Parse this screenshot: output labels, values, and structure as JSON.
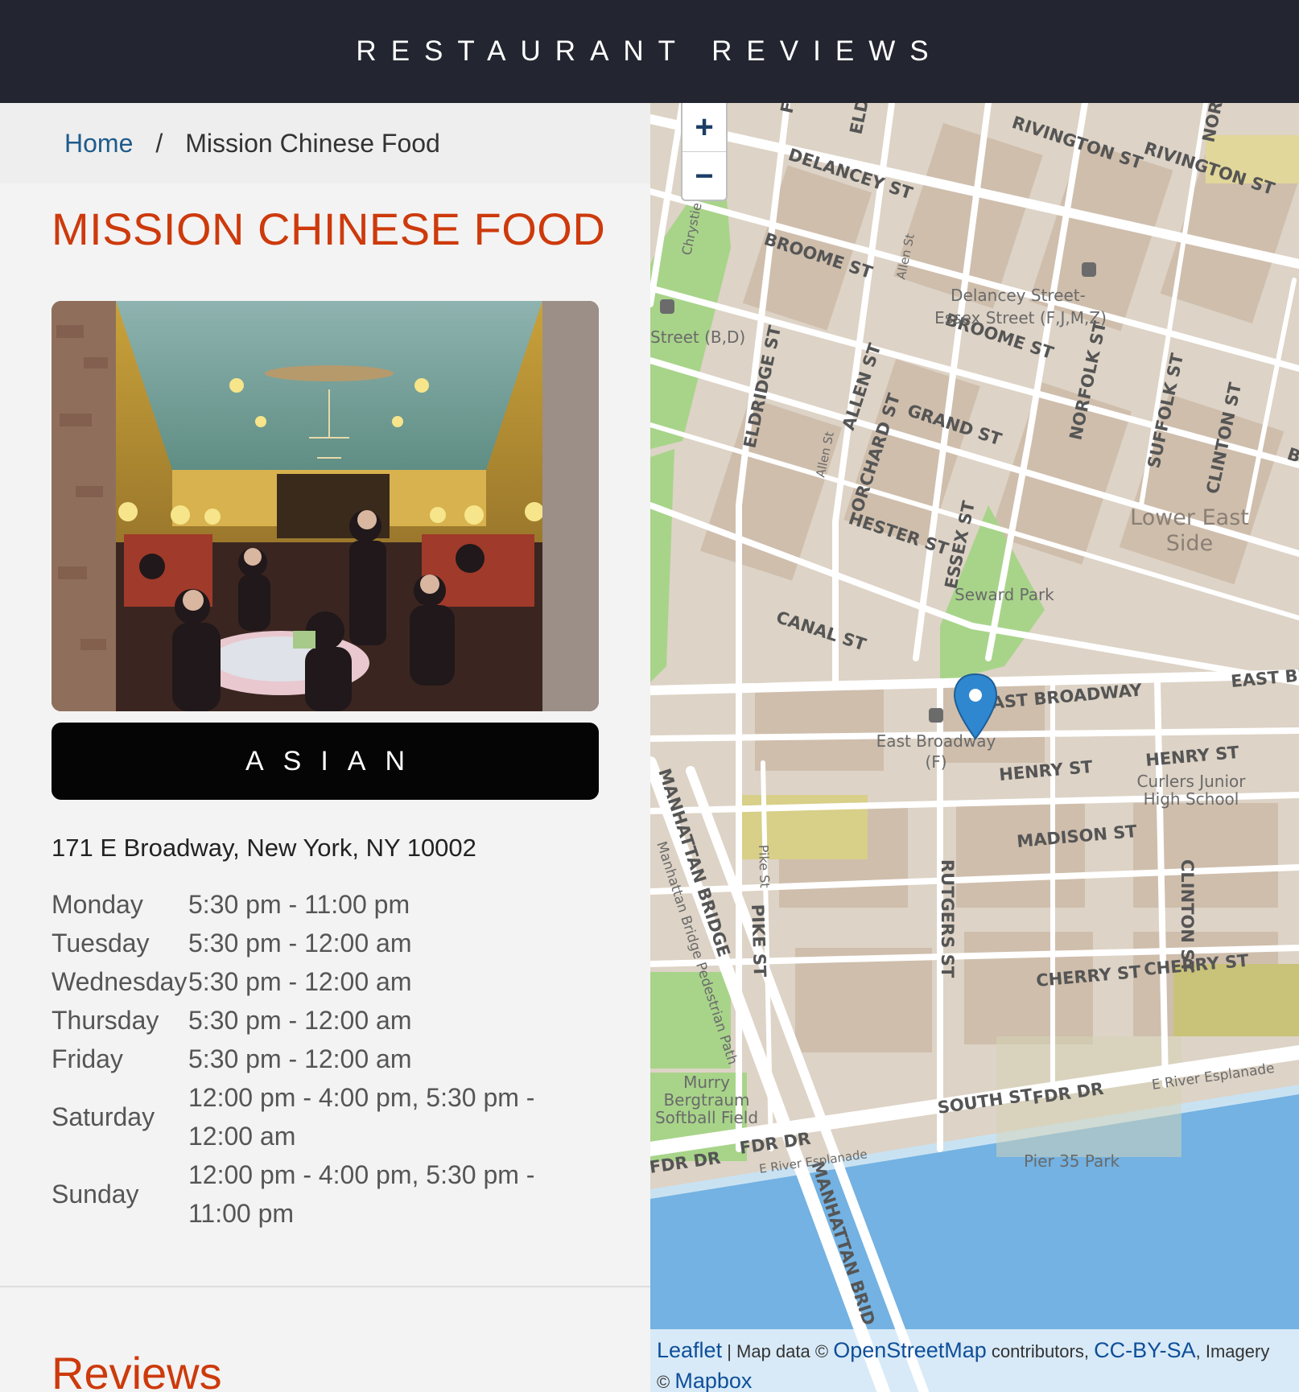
{
  "header": {
    "title": "RESTAURANT REVIEWS"
  },
  "breadcrumb": {
    "home": "Home",
    "separator": "/",
    "current": "Mission Chinese Food"
  },
  "restaurant": {
    "name": "MISSION CHINESE FOOD",
    "cuisine": "ASIAN",
    "address": "171 E Broadway, New York, NY 10002",
    "hours": [
      {
        "day": "Monday",
        "time": "5:30 pm - 11:00 pm"
      },
      {
        "day": "Tuesday",
        "time": "5:30 pm - 12:00 am"
      },
      {
        "day": "Wednesday",
        "time": "5:30 pm - 12:00 am"
      },
      {
        "day": "Thursday",
        "time": "5:30 pm - 12:00 am"
      },
      {
        "day": "Friday",
        "time": "5:30 pm - 12:00 am"
      },
      {
        "day": "Saturday",
        "time": "12:00 pm - 4:00 pm, 5:30 pm - 12:00 am"
      },
      {
        "day": "Sunday",
        "time": "12:00 pm - 4:00 pm, 5:30 pm - 11:00 pm"
      }
    ]
  },
  "reviews": {
    "title": "Reviews"
  },
  "map": {
    "zoom_in": "+",
    "zoom_out": "−",
    "labels": {
      "delancey": "DELANCEY ST",
      "rivington1": "RIVINGTON ST",
      "rivington2": "RIVINGTON ST",
      "broome1": "BROOME ST",
      "broome2": "BROOME ST",
      "station_delancey_1": "Delancey Street-",
      "station_delancey_2": "Essex Street (F,J,M,Z)",
      "station_left": "Street (B,D)",
      "grand": "GRAND ST",
      "hester": "HESTER ST",
      "canal": "CANAL ST",
      "allen": "ALLEN ST",
      "orchard": "ORCHARD ST",
      "eldridge": "ELDRIDGE ST",
      "essex": "ESSEX ST",
      "norfolk": "NORFOLK ST",
      "suffolk": "SUFFOLK ST",
      "clinton": "CLINTON ST",
      "clinton2": "CLINTON ST",
      "les_1": "Lower East",
      "les_2": "Side",
      "seward": "Seward Park",
      "east_broadway": "EAST BROADWAY",
      "east_broadway_r": "EAST BR",
      "station_eb_1": "East Broadway",
      "station_eb_2": "(F)",
      "henry1": "HENRY ST",
      "henry2": "HENRY ST",
      "curlers_1": "Curlers Junior",
      "curlers_2": "High School",
      "madison": "MADISON ST",
      "rutgers": "RUTGERS ST",
      "pike_small": "Pike St",
      "pike": "PIKE ST",
      "manhattan_bridge": "MANHATTAN BRIDGE",
      "manhattan_bridge2": "MANHATTAN BRID",
      "pedestrian": "Manhattan Bridge Pedestrian Path",
      "cherry1": "CHERRY ST",
      "cherry2": "CHERRY ST",
      "murry_1": "Murry",
      "murry_2": "Bergtraum",
      "murry_3": "Softball Field",
      "south": "SOUTH ST",
      "fdr1": "FDR DR",
      "fdr2": "FDR DR",
      "fdr3": "FDR DR",
      "esplanade1": "E River Esplanade",
      "esplanade2": "E River Esplanade",
      "pier35": "Pier 35 Park",
      "chrystie": "Chrystie",
      "eldridge_top": "ELDRID",
      "forsyth_top": "FOR",
      "norfolk_top": "NORFO",
      "allen_small": "Allen St",
      "allen_small2": "Allen St",
      "br_right": "BR"
    },
    "attribution": {
      "leaflet": "Leaflet",
      "sep": " | Map data © ",
      "osm": "OpenStreetMap",
      "contrib": " contributors, ",
      "license": "CC-BY-SA",
      "imagery": ", Imagery",
      "copy": "© ",
      "mapbox": "Mapbox"
    }
  },
  "colors": {
    "header_bg": "#232630",
    "accent": "#cd3a0c",
    "link": "#1e5c8c",
    "water": "#73b2e2",
    "park": "#a8d48a",
    "land": "#ddd3c6",
    "road": "#ffffff",
    "marker": "#2f87d0"
  }
}
